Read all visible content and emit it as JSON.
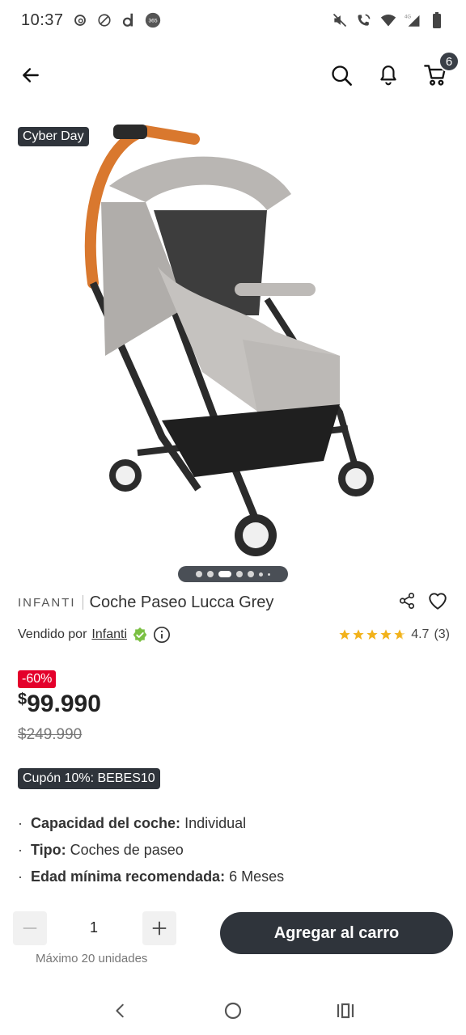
{
  "status_bar": {
    "time": "10:37",
    "left_icons": [
      "threads-icon",
      "blocked-icon",
      "d-app-icon",
      "365-app-icon"
    ],
    "right_icons": [
      "mute-icon",
      "wifi-call-icon",
      "wifi-icon",
      "signal-4g-icon",
      "battery-icon"
    ],
    "network": "4G"
  },
  "header": {
    "back_icon": "arrow-left-icon",
    "search_icon": "search-icon",
    "notifications_icon": "bell-icon",
    "cart_icon": "cart-icon",
    "cart_count": "6"
  },
  "image": {
    "badge": "Cyber Day",
    "carousel": {
      "total": 8,
      "active_index": 2
    }
  },
  "product": {
    "brand": "INFANTI",
    "name": "Coche Paseo Lucca Grey",
    "seller_prefix": "Vendido por",
    "seller": "Infanti",
    "rating": "4.7",
    "reviews": "(3)",
    "stars": 4.7
  },
  "pricing": {
    "discount": "-60%",
    "currency": "$",
    "price": "99.990",
    "old_price": "$249.990"
  },
  "coupon": "Cupón 10%: BEBES10",
  "specs": [
    {
      "key": "Capacidad del coche:",
      "value": "Individual"
    },
    {
      "key": "Tipo:",
      "value": "Coches de paseo"
    },
    {
      "key": "Edad mínima recomendada:",
      "value": "6 Meses"
    }
  ],
  "cart_action": {
    "quantity": "1",
    "max_hint": "Máximo 20 unidades",
    "button": "Agregar al carro"
  },
  "colors": {
    "dark": "#2f343b",
    "discount": "#e4002b",
    "star": "#f2b21b",
    "verified": "#7bc043"
  }
}
